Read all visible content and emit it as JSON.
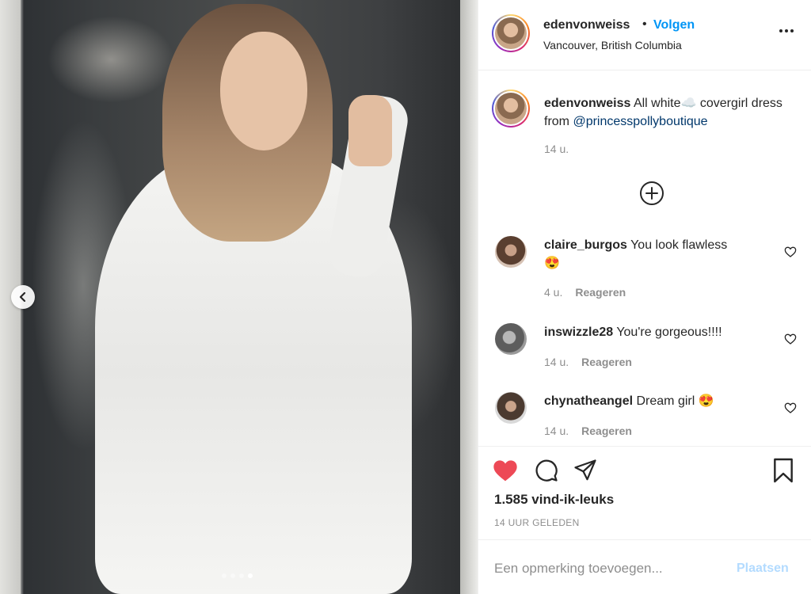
{
  "post": {
    "username": "edenvonweiss",
    "separator": "•",
    "follow_label": "Volgen",
    "location": "Vancouver, British Columbia",
    "caption_pre": "All white",
    "caption_emoji": "☁️",
    "caption_post": " covergirl dress from ",
    "caption_mention": "@princesspollyboutique",
    "caption_time": "14 u.",
    "likes": "1.585 vind-ik-leuks",
    "posted_ago": "14 UUR GELEDEN",
    "carousel": {
      "total": 4,
      "active_index": 3
    }
  },
  "comments": [
    {
      "user": "claire_burgos",
      "text": "You look flawless",
      "emoji": "😍",
      "time": "4 u.",
      "reply": "Reageren"
    },
    {
      "user": "inswizzle28",
      "text": "You're gorgeous!!!!",
      "emoji": "",
      "time": "14 u.",
      "reply": "Reageren"
    },
    {
      "user": "chynatheangel",
      "text": "Dream girl",
      "emoji": "😍",
      "time": "14 u.",
      "reply": "Reageren"
    }
  ],
  "composer": {
    "placeholder": "Een opmerking toevoegen...",
    "post_label": "Plaatsen"
  },
  "colors": {
    "link_blue": "#0095f6",
    "like_red": "#ed4956",
    "post_disabled": "#b3dbff"
  },
  "icons": {
    "more": "more-options-icon",
    "load_more": "plus-circle-icon",
    "like": "heart-icon",
    "comment": "comment-icon",
    "share": "share-icon",
    "save": "bookmark-icon",
    "prev": "chevron-left-icon"
  }
}
